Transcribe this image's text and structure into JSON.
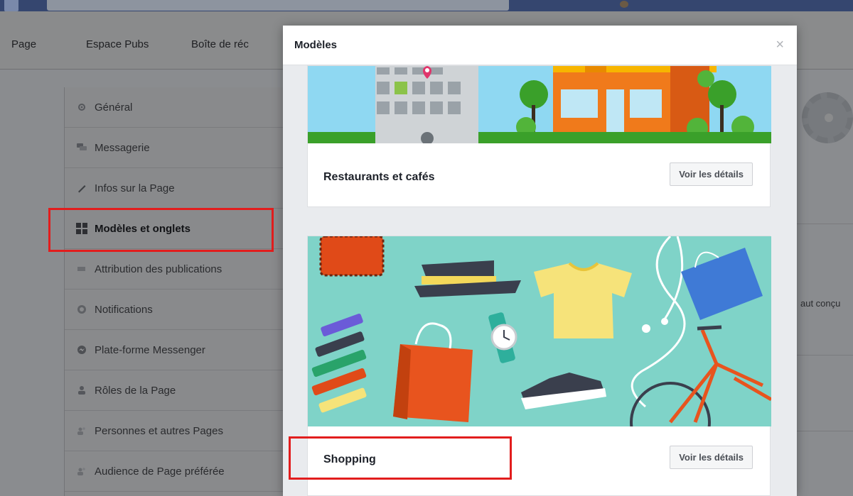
{
  "nav": {
    "items": [
      "Page",
      "Espace Pubs",
      "Boîte de réc"
    ]
  },
  "menu": {
    "items": [
      {
        "label": "Général",
        "icon": "gear-icon",
        "active": false
      },
      {
        "label": "Messagerie",
        "icon": "chat-icon",
        "active": false
      },
      {
        "label": "Infos sur la Page",
        "icon": "pencil-icon",
        "active": false
      },
      {
        "label": "Modèles et onglets",
        "icon": "grid-icon",
        "active": true
      },
      {
        "label": "Attribution des publications",
        "icon": "flag-icon",
        "active": false
      },
      {
        "label": "Notifications",
        "icon": "globe-icon",
        "active": false
      },
      {
        "label": "Plate-forme Messenger",
        "icon": "messenger-icon",
        "active": false
      },
      {
        "label": "Rôles de la Page",
        "icon": "person-icon",
        "active": false
      },
      {
        "label": "Personnes et autres Pages",
        "icon": "people-icon",
        "active": false
      },
      {
        "label": "Audience de Page préférée",
        "icon": "people-icon",
        "active": false
      }
    ]
  },
  "background": {
    "partial_text": "aut conçu"
  },
  "modal": {
    "title": "Modèles",
    "close_glyph": "×",
    "templates": [
      {
        "name": "Restaurants et cafés",
        "button": "Voir les détails"
      },
      {
        "name": "Shopping",
        "button": "Voir les détails"
      }
    ]
  },
  "colors": {
    "topbar": "#35466f",
    "highlight": "#e21d1d",
    "shopping_bg": "#7fd3c8",
    "restaurant_sky": "#8fd8f2",
    "grass": "#3aa02a"
  }
}
